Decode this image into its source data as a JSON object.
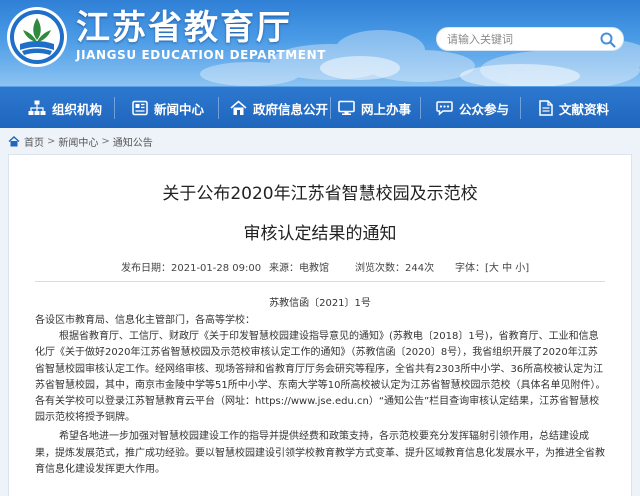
{
  "header": {
    "title": "江苏省教育厅",
    "subtitle": "JIANGSU EDUCATION DEPARTMENT",
    "search_placeholder": "请输入关键词"
  },
  "nav": {
    "items": [
      {
        "label": "组织机构",
        "icon": "org-chart-icon"
      },
      {
        "label": "新闻中心",
        "icon": "newspaper-icon"
      },
      {
        "label": "政府信息公开",
        "icon": "house-icon"
      },
      {
        "label": "网上办事",
        "icon": "monitor-icon"
      },
      {
        "label": "公众参与",
        "icon": "chat-icon"
      },
      {
        "label": "文献资料",
        "icon": "document-icon"
      }
    ]
  },
  "breadcrumb": {
    "items": [
      "首页",
      "新闻中心",
      "通知公告"
    ],
    "separator": ">"
  },
  "article": {
    "title_line1": "关于公布2020年江苏省智慧校园及示范校",
    "title_line2": "审核认定结果的通知",
    "publish_time": "发布日期：2021-01-28 09:00",
    "source": "来源：电教馆",
    "views": "浏览次数：244次",
    "font_size_label": "字体：[大 中 小]",
    "doc_number": "苏教信函〔2021〕1号",
    "salutation": "各设区市教育局、信息化主管部门，各高等学校：",
    "paragraph1": "根据省教育厅、工信厅、财政厅《关于印发智慧校园建设指导意见的通知》(苏教电〔2018〕1号)，省教育厅、工业和信息化厅《关于做好2020年江苏省智慧校园及示范校审核认定工作的通知》（苏教信函〔2020〕8号），我省组织开展了2020年江苏省智慧校园审核认定工作。经网络审核、现场答辩和省教育厅厅务会研究等程序，全省共有2303所中小学、36所高校被认定为江苏省智慧校园，其中，南京市金陵中学等51所中小学、东南大学等10所高校被认定为江苏省智慧校园示范校（具体名单见附件）。各有关学校可以登录江苏智慧教育云平台（网址：https://www.jse.edu.cn）“通知公告”栏目查询审核认定结果，江苏省智慧校园示范校将授予铜牌。",
    "paragraph2": "希望各地进一步加强对智慧校园建设工作的指导并提供经费和政策支持，各示范校要充分发挥辐射引领作用，总结建设成果，提炼发展范式，推广成功经验。要以智慧校园建设引领学校教育教学方式变革、提升区域教育信息化发展水平，为推进全省教育信息化建设发挥更大作用。"
  },
  "colors": {
    "header_top": "#2f7fd6",
    "nav_bg": "#1f66bd",
    "page_bg": "#eef3f9"
  }
}
